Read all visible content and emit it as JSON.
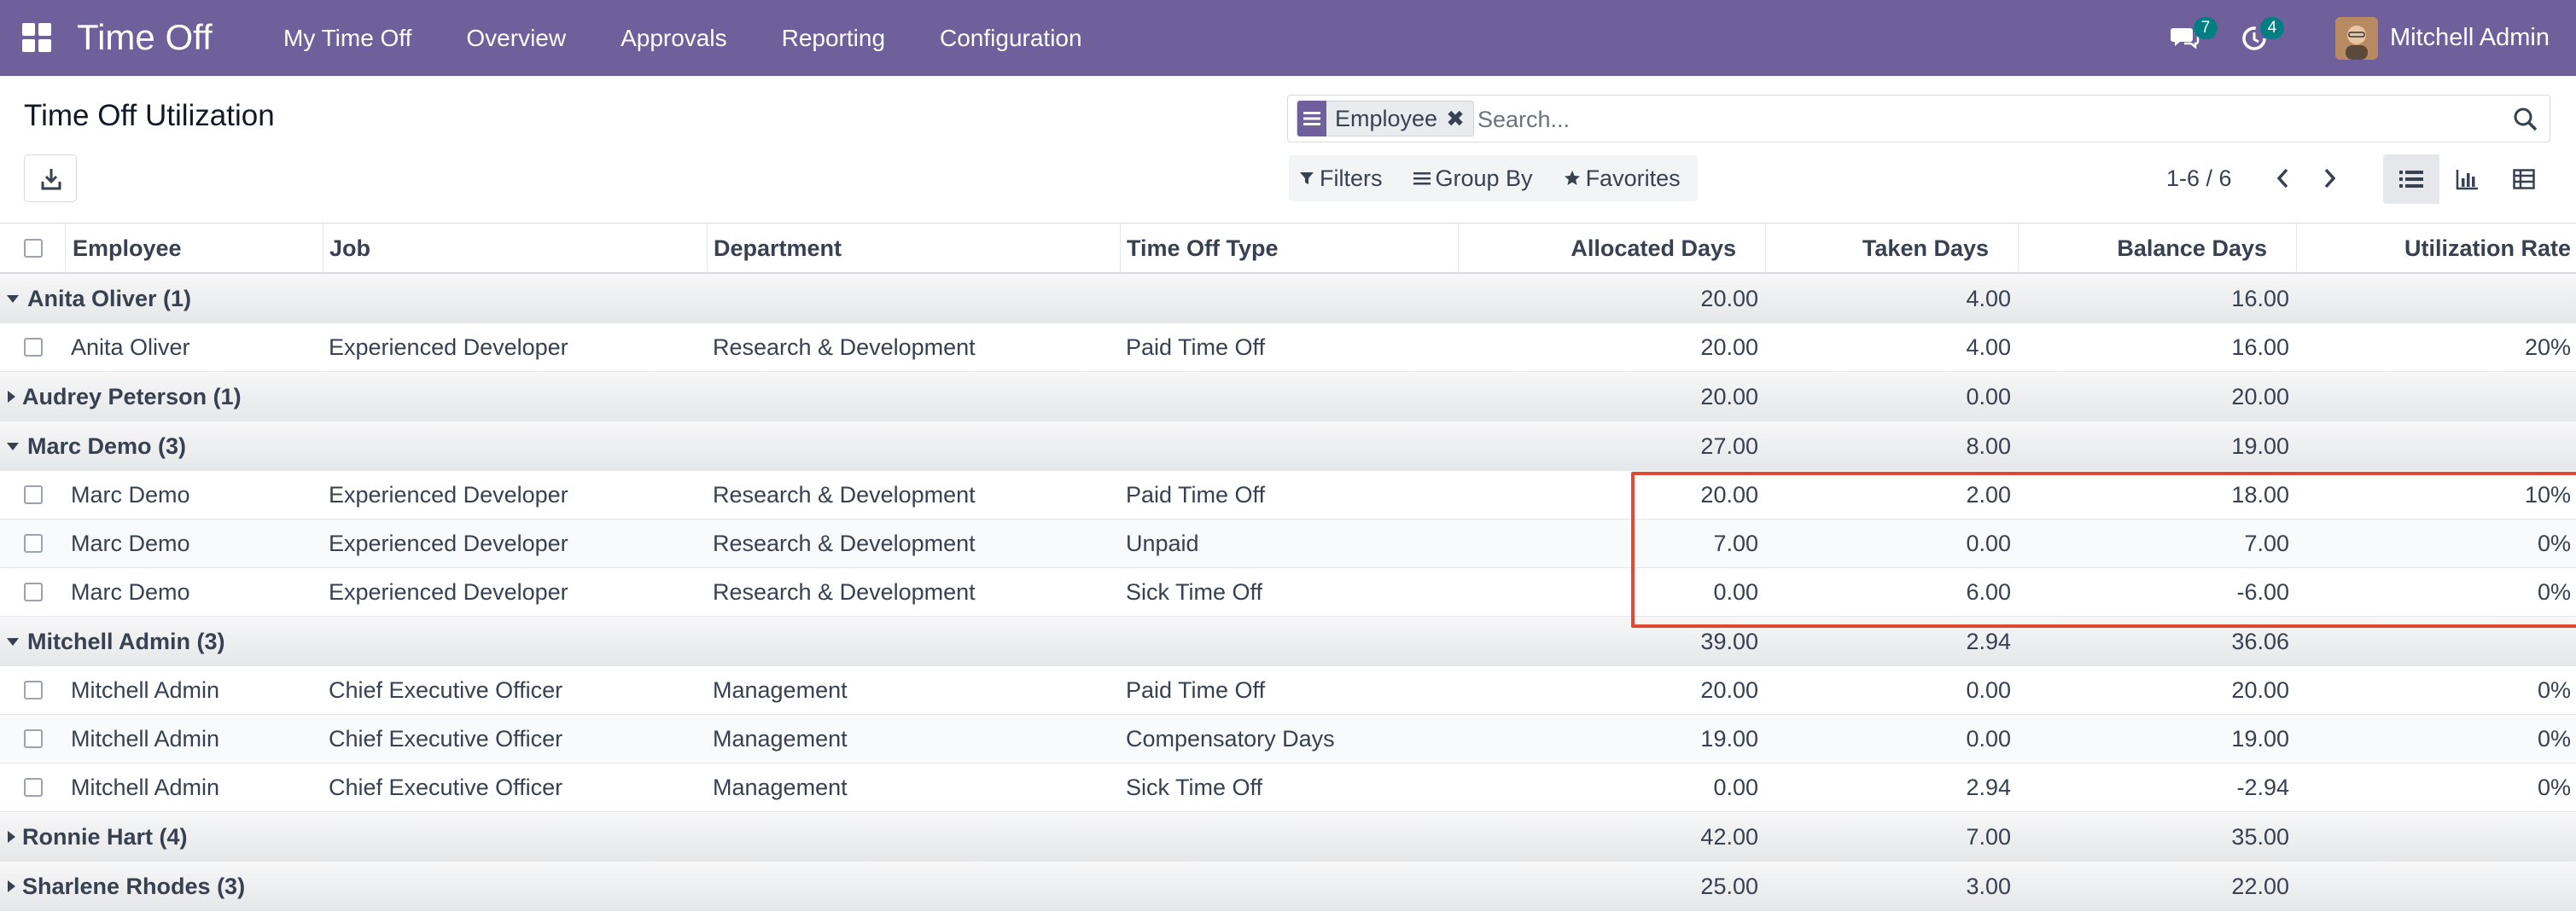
{
  "nav": {
    "app_title": "Time Off",
    "menu": [
      "My Time Off",
      "Overview",
      "Approvals",
      "Reporting",
      "Configuration"
    ],
    "messages_count": "7",
    "activities_count": "4",
    "user_name": "Mitchell Admin"
  },
  "control": {
    "page_title": "Time Off Utilization",
    "facet_label": "Employee",
    "search_placeholder": "Search...",
    "filters_label": "Filters",
    "groupby_label": "Group By",
    "favorites_label": "Favorites",
    "pager": "1-6 / 6"
  },
  "columns": [
    "Employee",
    "Job",
    "Department",
    "Time Off Type",
    "Allocated Days",
    "Taken Days",
    "Balance Days",
    "Utilization Rate"
  ],
  "groups": [
    {
      "name": "Anita Oliver (1)",
      "open": true,
      "allocated": "20.00",
      "taken": "4.00",
      "balance": "16.00",
      "records": [
        {
          "employee": "Anita Oliver",
          "job": "Experienced Developer",
          "department": "Research & Development",
          "type": "Paid Time Off",
          "allocated": "20.00",
          "taken": "4.00",
          "balance": "16.00",
          "rate": "20%"
        }
      ]
    },
    {
      "name": "Audrey Peterson (1)",
      "open": false,
      "allocated": "20.00",
      "taken": "0.00",
      "balance": "20.00",
      "records": []
    },
    {
      "name": "Marc Demo (3)",
      "open": true,
      "allocated": "27.00",
      "taken": "8.00",
      "balance": "19.00",
      "records": [
        {
          "employee": "Marc Demo",
          "job": "Experienced Developer",
          "department": "Research & Development",
          "type": "Paid Time Off",
          "allocated": "20.00",
          "taken": "2.00",
          "balance": "18.00",
          "rate": "10%"
        },
        {
          "employee": "Marc Demo",
          "job": "Experienced Developer",
          "department": "Research & Development",
          "type": "Unpaid",
          "allocated": "7.00",
          "taken": "0.00",
          "balance": "7.00",
          "rate": "0%"
        },
        {
          "employee": "Marc Demo",
          "job": "Experienced Developer",
          "department": "Research & Development",
          "type": "Sick Time Off",
          "allocated": "0.00",
          "taken": "6.00",
          "balance": "-6.00",
          "rate": "0%"
        }
      ]
    },
    {
      "name": "Mitchell Admin (3)",
      "open": true,
      "allocated": "39.00",
      "taken": "2.94",
      "balance": "36.06",
      "records": [
        {
          "employee": "Mitchell Admin",
          "job": "Chief Executive Officer",
          "department": "Management",
          "type": "Paid Time Off",
          "allocated": "20.00",
          "taken": "0.00",
          "balance": "20.00",
          "rate": "0%"
        },
        {
          "employee": "Mitchell Admin",
          "job": "Chief Executive Officer",
          "department": "Management",
          "type": "Compensatory Days",
          "allocated": "19.00",
          "taken": "0.00",
          "balance": "19.00",
          "rate": "0%"
        },
        {
          "employee": "Mitchell Admin",
          "job": "Chief Executive Officer",
          "department": "Management",
          "type": "Sick Time Off",
          "allocated": "0.00",
          "taken": "2.94",
          "balance": "-2.94",
          "rate": "0%"
        }
      ]
    },
    {
      "name": "Ronnie Hart (4)",
      "open": false,
      "allocated": "42.00",
      "taken": "7.00",
      "balance": "35.00",
      "records": []
    },
    {
      "name": "Sharlene Rhodes (3)",
      "open": false,
      "allocated": "25.00",
      "taken": "3.00",
      "balance": "22.00",
      "records": []
    }
  ],
  "colors": {
    "brand": "#6f5f9a",
    "badge": "#017e84",
    "highlight": "#e04a33"
  }
}
